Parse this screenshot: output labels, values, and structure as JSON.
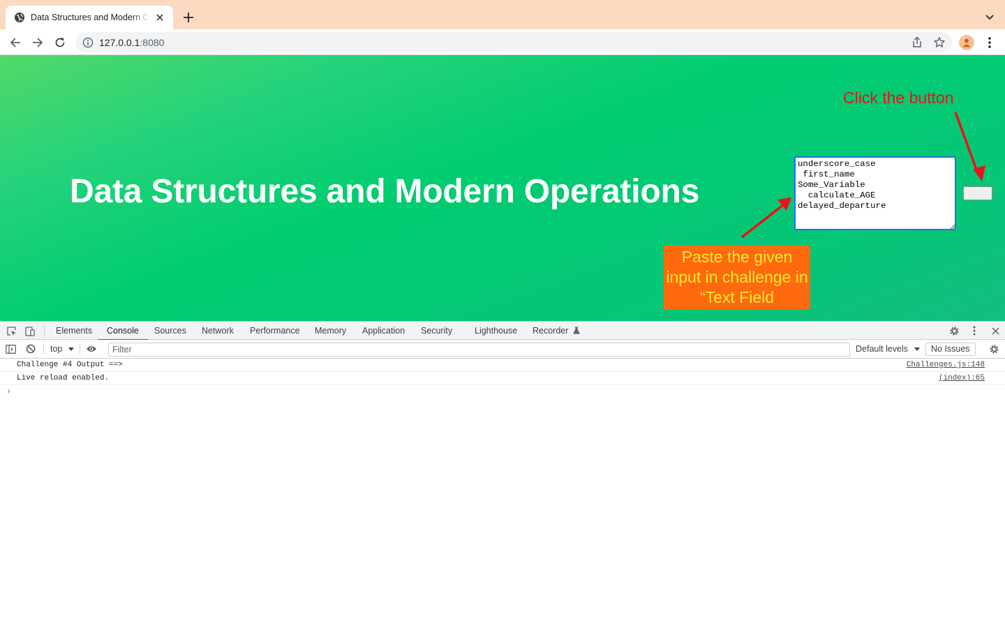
{
  "browser": {
    "tab_title": "Data Structures and Modern Operations",
    "url_host": "127.0.0.1",
    "url_port": ":8080"
  },
  "page": {
    "heading": "Data Structures and Modern Operations",
    "textarea_value": "underscore_case\n first_name\nSome_Variable\n  calculate_AGE\ndelayed_departure",
    "button_label": ""
  },
  "annotations": {
    "click_hint": "Click the button",
    "paste_hint": "Paste the given input in challenge in “Text Field",
    "colors": {
      "arrow": "#e8141a",
      "box_bg": "#ff6a0e",
      "box_text": "#ffea33"
    }
  },
  "devtools": {
    "tabs": [
      "Elements",
      "Console",
      "Sources",
      "Network",
      "Performance",
      "Memory",
      "Application",
      "Security",
      "Lighthouse",
      "Recorder"
    ],
    "active_tab": "Console",
    "context": "top",
    "filter_placeholder": "Filter",
    "levels_label": "Default levels",
    "issues_label": "No Issues",
    "console": [
      {
        "message": "Challenge #4 Output ==>",
        "source": "Challenges.js:148"
      },
      {
        "message": "Live reload enabled.",
        "source": "(index):65"
      }
    ],
    "prompt_symbol": "›"
  },
  "colors": {
    "accent": "#1a73e8",
    "tabstrip": "#fdd9c1",
    "page_gradient": [
      "#53d869",
      "#00cc70",
      "#14bd80"
    ]
  }
}
